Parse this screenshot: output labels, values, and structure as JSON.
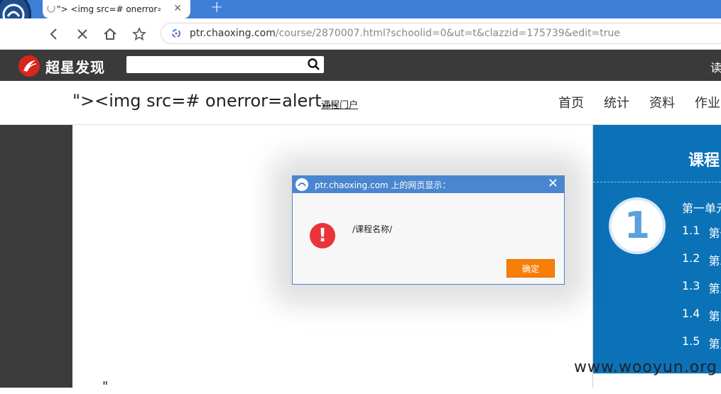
{
  "browser": {
    "tab_title": "\"> <img src=# onerror=",
    "new_tab_label": "+",
    "url_host": "ptr.chaoxing.com",
    "url_path": "/course/2870007.html?schoolid=0&ut=t&clazzid=175739&edit=true"
  },
  "site": {
    "logo_text": "超星发现",
    "search_placeholder": "",
    "read_label": "读"
  },
  "course": {
    "title": "\"><img src=# onerror=alert...",
    "portal_link": "课程门户",
    "nav": [
      "首页",
      "统计",
      "资料",
      "作业"
    ]
  },
  "panel": {
    "title": "课程",
    "chapter_number": "1",
    "unit_label": "第一单元",
    "lessons": [
      {
        "num": "1.1",
        "name": "第一"
      },
      {
        "num": "1.2",
        "name": "第二"
      },
      {
        "num": "1.3",
        "name": "第三"
      },
      {
        "num": "1.4",
        "name": "第四"
      },
      {
        "num": "1.5",
        "name": "第五"
      }
    ]
  },
  "page": {
    "stray_quote": "\""
  },
  "dialog": {
    "title": "ptr.chaoxing.com 上的网页显示：",
    "message": "/课程名称/",
    "ok_label": "确定",
    "close_label": "✕"
  },
  "watermark": "www.wooyun.org",
  "colors": {
    "tab_strip": "#3d7fd6",
    "site_header": "#3a3a3a",
    "panel": "#0b72b8",
    "dialog_title": "#4a86cf",
    "ok_button": "#f77f08",
    "alert_icon": "#e8343a"
  }
}
